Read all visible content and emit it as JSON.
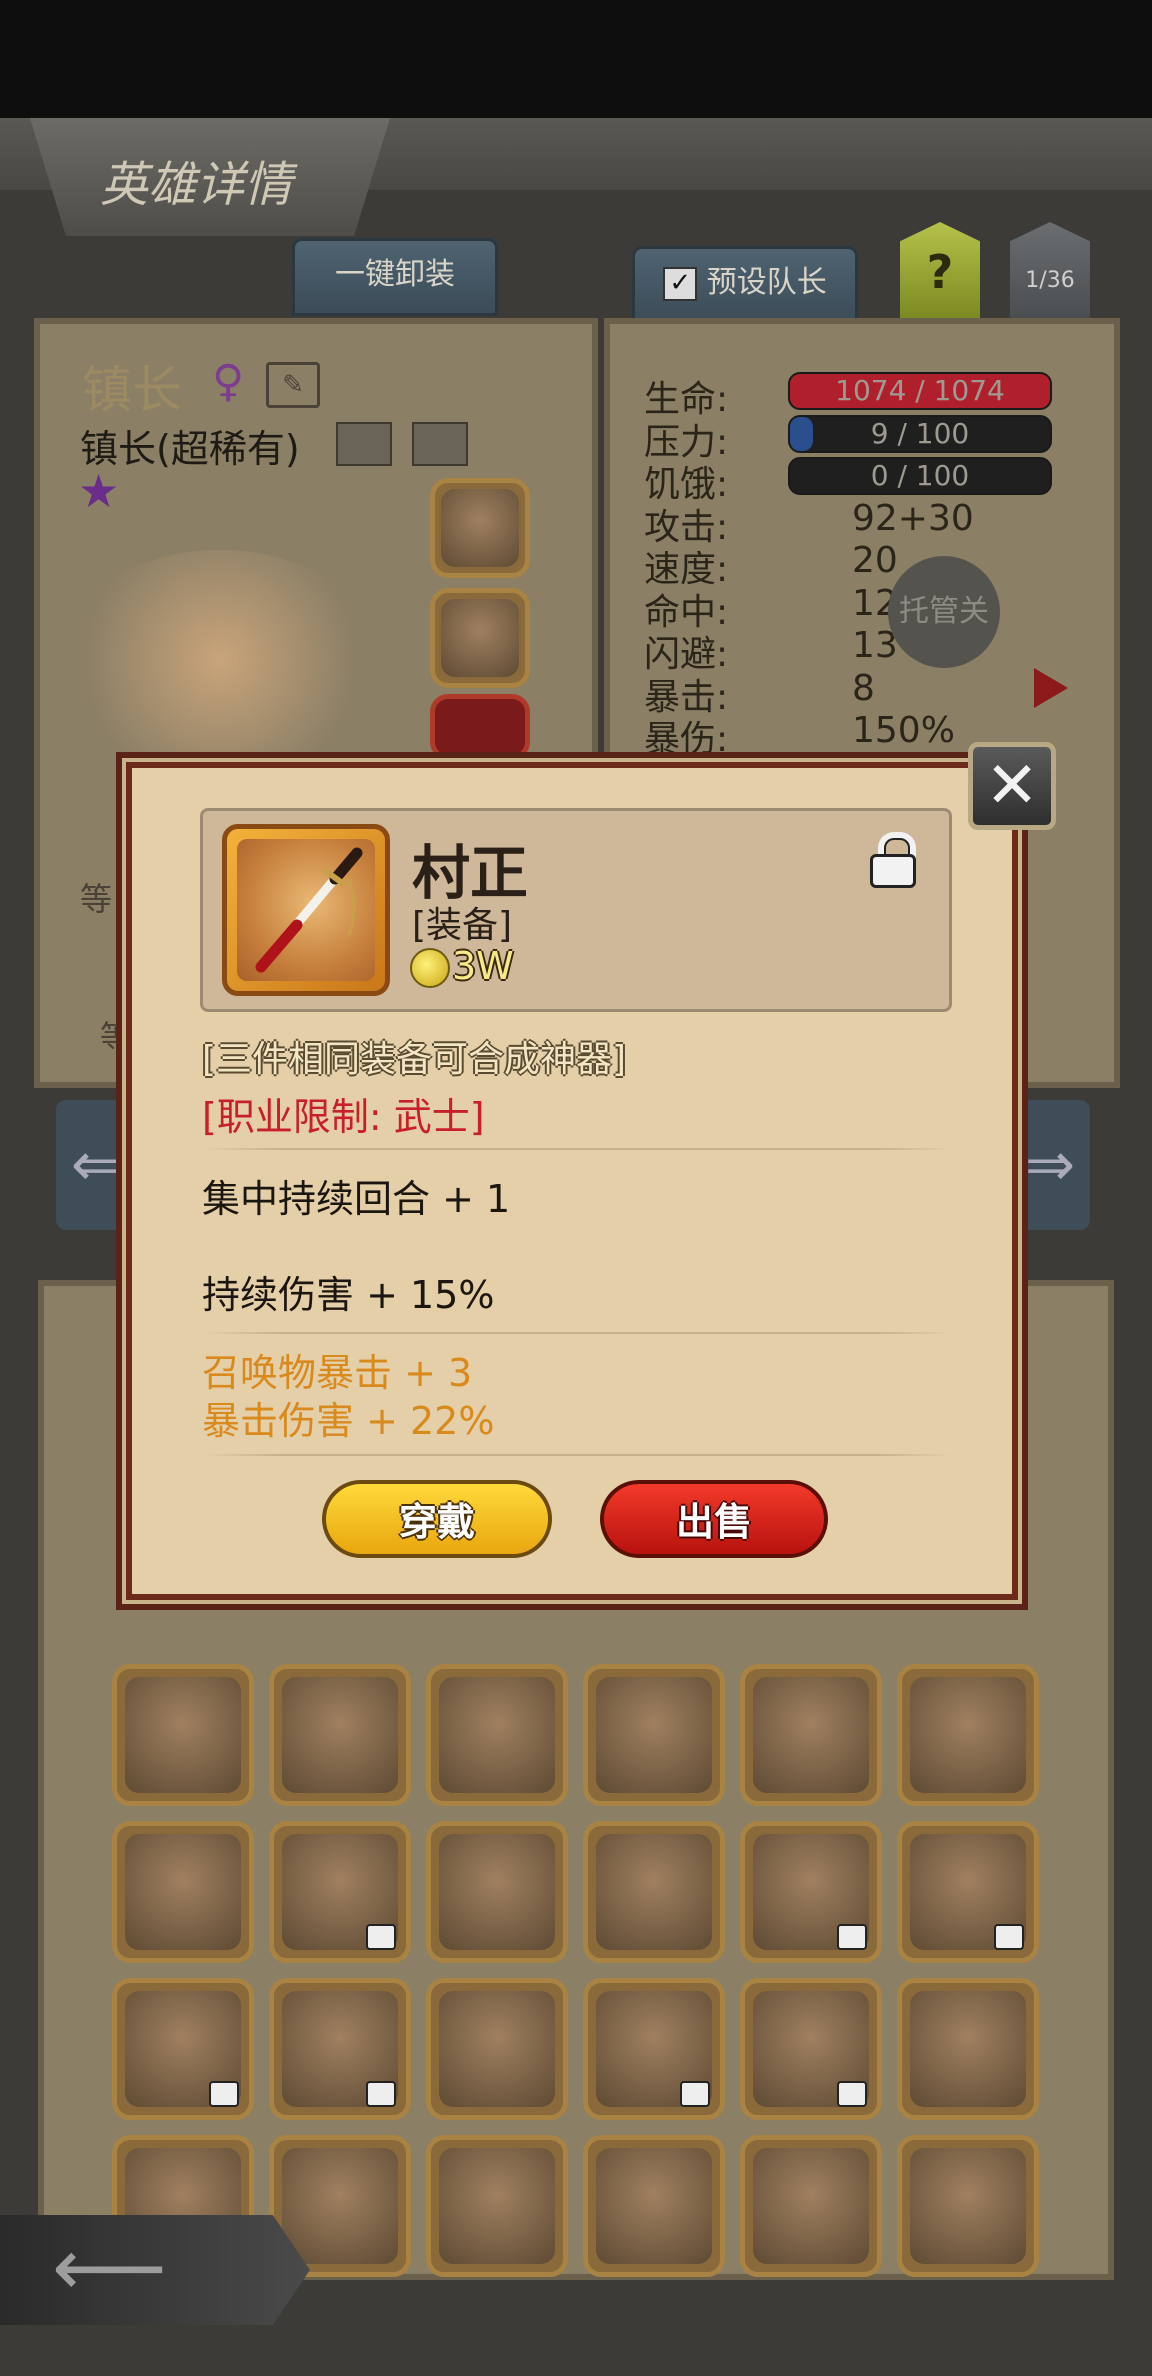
{
  "header": {
    "title": "英雄详情"
  },
  "tabs": {
    "unequip_all": "一键卸装",
    "preset_leader": "预设队长",
    "help": "?",
    "page_indicator": "1/36"
  },
  "hero": {
    "name": "镇长",
    "subtitle": "镇长(超稀有)",
    "stars": 1
  },
  "stats": [
    {
      "label": "生命:",
      "value": "1074 / 1074",
      "kind": "bar",
      "fill": 1.0,
      "color": "#b0202c"
    },
    {
      "label": "压力:",
      "value": "9 / 100",
      "kind": "bar",
      "fill": 0.09,
      "color": "#2a4f8c"
    },
    {
      "label": "饥饿:",
      "value": "0 / 100",
      "kind": "bar",
      "fill": 0.0,
      "color": "#333333"
    },
    {
      "label": "攻击:",
      "value": "92+30",
      "kind": "text"
    },
    {
      "label": "速度:",
      "value": "20",
      "kind": "text"
    },
    {
      "label": "命中:",
      "value": "121",
      "kind": "text"
    },
    {
      "label": "闪避:",
      "value": "13",
      "kind": "text"
    },
    {
      "label": "暴击:",
      "value": "8",
      "kind": "text"
    },
    {
      "label": "暴伤:",
      "value": "150%",
      "kind": "text"
    }
  ],
  "auto_button": "托管关",
  "side_labels": {
    "level": "等",
    "bottom": "等"
  },
  "popup": {
    "item_name": "村正",
    "item_type": "[装备]",
    "price": "3W",
    "lock_icon": "padlock-icon",
    "fusion_note": "[三件相同装备可合成神器]",
    "class_limit": "[职业限制: 武士]",
    "base_stats": [
      "集中持续回合 + 1",
      "持续伤害 + 15%"
    ],
    "bonus_stats": [
      "召唤物暴击 + 3",
      "暴击伤害 + 22%"
    ],
    "equip_button": "穿戴",
    "sell_button": "出售",
    "colors": {
      "class_limit": "#c8202a",
      "bonus": "#d98a1c",
      "fusion": "#f2e6c4"
    }
  },
  "inventory": {
    "rows": [
      [
        "pistol-icon",
        "pistol-icon",
        "pistol-icon",
        "axe-icon",
        "mace-icon",
        "drill-lance-icon"
      ],
      [
        "sword-icon",
        "chest-locked-icon",
        "chest-icon",
        "chest-icon",
        "chest-locked-icon",
        "chest-locked-icon"
      ],
      [
        "chest-locked-icon",
        "chest-locked-icon",
        "chest-icon",
        "chest-locked-icon",
        "chest-locked-icon",
        "chest-icon"
      ],
      [
        "chest-icon",
        "chest-icon",
        "chest-icon",
        "chest-icon",
        "chest-icon",
        "chest-icon"
      ]
    ]
  }
}
